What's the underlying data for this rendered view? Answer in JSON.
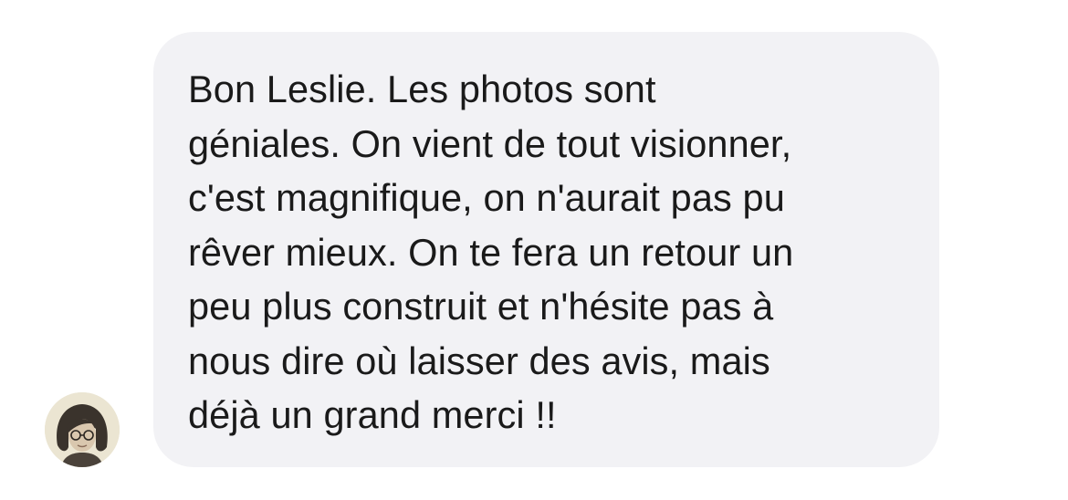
{
  "message": {
    "avatar_icon": "user-avatar-photo",
    "text": "Bon Leslie. Les photos sont\ngéniales. On vient de tout visionner,\nc'est magnifique, on n'aurait pas pu\nrêver mieux. On te fera un retour un\npeu plus construit et n'hésite pas à\nnous dire où laisser des avis, mais\ndéjà un grand merci !!",
    "bubble_color": "#f2f2f5",
    "text_color": "#1a1a1a"
  }
}
